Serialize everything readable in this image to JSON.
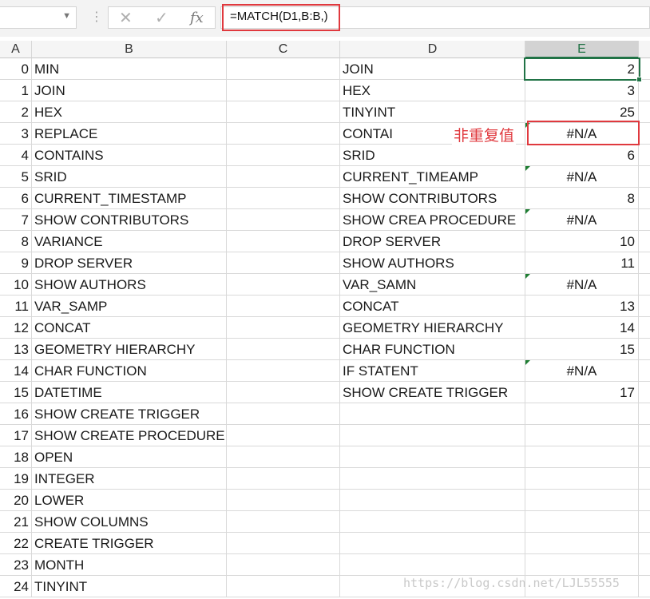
{
  "formula_bar": {
    "name_box": "",
    "cancel_icon": "✕",
    "enter_icon": "✓",
    "fx_label": "fx",
    "formula": "=MATCH(D1,B:B,)"
  },
  "columns": [
    "A",
    "B",
    "C",
    "D",
    "E"
  ],
  "selected_column": "E",
  "rows": [
    {
      "a": "0",
      "b": "MIN",
      "d": "JOIN",
      "e": "2"
    },
    {
      "a": "1",
      "b": "JOIN",
      "d": "HEX",
      "e": "3"
    },
    {
      "a": "2",
      "b": "HEX",
      "d": "TINYINT",
      "e": "25"
    },
    {
      "a": "3",
      "b": "REPLACE",
      "d": "CONTAI",
      "e": "#N/A"
    },
    {
      "a": "4",
      "b": "CONTAINS",
      "d": "SRID",
      "e": "6"
    },
    {
      "a": "5",
      "b": "SRID",
      "d": "CURRENT_TIMEAMP",
      "e": "#N/A"
    },
    {
      "a": "6",
      "b": "CURRENT_TIMESTAMP",
      "d": "SHOW CONTRIBUTORS",
      "e": "8"
    },
    {
      "a": "7",
      "b": "SHOW CONTRIBUTORS",
      "d": "SHOW CREA PROCEDURE",
      "e": "#N/A"
    },
    {
      "a": "8",
      "b": "VARIANCE",
      "d": "DROP SERVER",
      "e": "10"
    },
    {
      "a": "9",
      "b": "DROP SERVER",
      "d": "SHOW AUTHORS",
      "e": "11"
    },
    {
      "a": "10",
      "b": "SHOW AUTHORS",
      "d": "VAR_SAMN",
      "e": "#N/A"
    },
    {
      "a": "11",
      "b": "VAR_SAMP",
      "d": "CONCAT",
      "e": "13"
    },
    {
      "a": "12",
      "b": "CONCAT",
      "d": "GEOMETRY HIERARCHY",
      "e": "14"
    },
    {
      "a": "13",
      "b": "GEOMETRY HIERARCHY",
      "d": "CHAR FUNCTION",
      "e": "15"
    },
    {
      "a": "14",
      "b": "CHAR FUNCTION",
      "d": "IF STATENT",
      "e": "#N/A"
    },
    {
      "a": "15",
      "b": "DATETIME",
      "d": "SHOW CREATE TRIGGER",
      "e": "17"
    },
    {
      "a": "16",
      "b": "SHOW CREATE TRIGGER",
      "d": "",
      "e": ""
    },
    {
      "a": "17",
      "b": "SHOW CREATE PROCEDURE",
      "d": "",
      "e": ""
    },
    {
      "a": "18",
      "b": "OPEN",
      "d": "",
      "e": ""
    },
    {
      "a": "19",
      "b": "INTEGER",
      "d": "",
      "e": ""
    },
    {
      "a": "20",
      "b": "LOWER",
      "d": "",
      "e": ""
    },
    {
      "a": "21",
      "b": "SHOW COLUMNS",
      "d": "",
      "e": ""
    },
    {
      "a": "22",
      "b": "CREATE TRIGGER",
      "d": "",
      "e": ""
    },
    {
      "a": "23",
      "b": "MONTH",
      "d": "",
      "e": ""
    },
    {
      "a": "24",
      "b": "TINYINT",
      "d": "",
      "e": ""
    }
  ],
  "annotation": "非重复值",
  "watermark": "https://blog.csdn.net/LJL55555",
  "colors": {
    "highlight": "#e0393e",
    "selection": "#217346",
    "error_marker": "#1e7d32"
  }
}
